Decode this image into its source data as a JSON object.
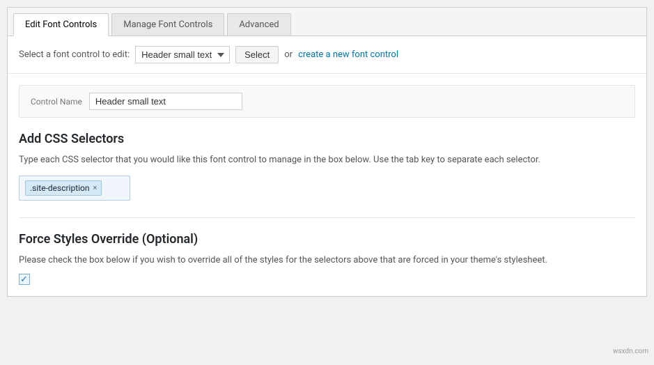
{
  "tabs": [
    {
      "id": "edit-font-controls",
      "label": "Edit Font Controls",
      "active": true
    },
    {
      "id": "manage-font-controls",
      "label": "Manage Font Controls",
      "active": false
    },
    {
      "id": "advanced",
      "label": "Advanced",
      "active": false
    }
  ],
  "select_bar": {
    "label": "Select a font control to edit:",
    "dropdown_value": "Header small text",
    "select_button_label": "Select",
    "or_text": "or",
    "create_link_text": "create a new font control"
  },
  "control_name": {
    "label": "Control Name",
    "value": "Header small text"
  },
  "css_selectors": {
    "heading": "Add CSS Selectors",
    "description": "Type each CSS selector that you would like this font control to manage in the box below. Use the tab key to separate each selector.",
    "tags": [
      {
        "text": ".site-description"
      }
    ]
  },
  "force_styles": {
    "heading": "Force Styles Override (Optional)",
    "description": "Please check the box below if you wish to override all of the styles for the selectors above that are forced in your theme's stylesheet.",
    "checked": true
  },
  "watermark": "wsxdn.com"
}
